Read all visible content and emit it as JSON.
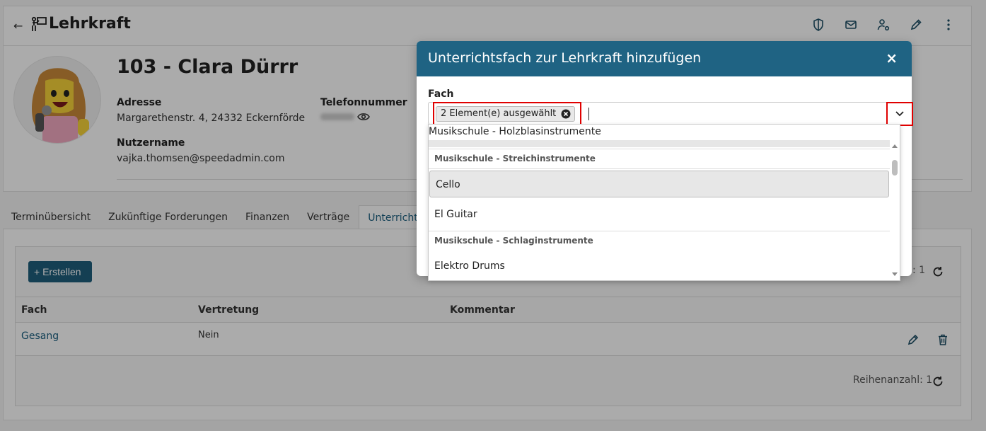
{
  "header": {
    "title": "Lehrkraft",
    "back_arrow": "←"
  },
  "profile": {
    "name": "103 - Clara Dürrr",
    "address_label": "Adresse",
    "address_value": "Margarethenstr. 4, 24332 Eckernförde",
    "phone_label": "Telefonnummer",
    "username_label": "Nutzername",
    "username_value": "vajka.thomsen@speedadmin.com"
  },
  "tabs": [
    {
      "label": "Terminübersicht"
    },
    {
      "label": "Zukünftige Forderungen"
    },
    {
      "label": "Finanzen"
    },
    {
      "label": "Verträge"
    },
    {
      "label": "Unterrichtsfä"
    }
  ],
  "grid": {
    "create_label": "+ Erstellen",
    "row_count_top": ": 1",
    "row_count_bottom": "Reihenanzahl: 1",
    "columns": [
      "Fach",
      "Vertretung",
      "Kommentar"
    ],
    "rows": [
      {
        "fach": "Gesang",
        "vertretung": "Nein",
        "kommentar": ""
      }
    ]
  },
  "modal": {
    "title": "Unterrichtsfach zur Lehrkraft hinzufügen",
    "close": "×",
    "field_label": "Fach",
    "chip_label": "2 Element(e) ausgewählt"
  },
  "dropdown": {
    "top_group": "Musikschule - Holzblasinstrumente",
    "groups": [
      {
        "label": "Musikschule - Streichinstrumente",
        "items": [
          "Cello",
          "El Guitar"
        ]
      },
      {
        "label": "Musikschule - Schlaginstrumente",
        "items": [
          "Elektro Drums"
        ]
      }
    ],
    "focused_item": "Cello"
  },
  "colors": {
    "accent": "#1f6383",
    "button": "#1f5f7d",
    "highlight": "#e00000",
    "link": "#1c6080"
  },
  "icons": [
    "back-arrow-icon",
    "teacher-icon",
    "shield-icon",
    "mail-icon",
    "user-settings-icon",
    "pencil-icon",
    "more-vertical-icon",
    "eye-icon",
    "refresh-icon",
    "trash-icon",
    "close-circle-icon",
    "chevron-down-icon"
  ]
}
